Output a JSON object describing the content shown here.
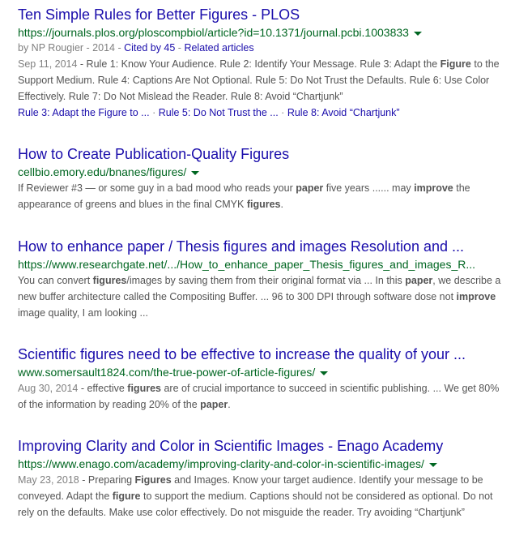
{
  "results": [
    {
      "title": "Ten Simple Rules for Better Figures - PLOS",
      "url": "https://journals.plos.org/ploscompbiol/article?id=10.1371/journal.pcbi.1003833",
      "meta": {
        "by": "by NP Rougier - 2014 - ",
        "cited_by": "Cited by 45",
        "sep": " - ",
        "related": "Related articles"
      },
      "date": "Sep 11, 2014",
      "snippet_parts": [
        " - Rule 1: Know Your Audience. Rule 2: Identify Your Message. Rule 3: Adapt the ",
        "Figure",
        " to the Support Medium. Rule 4: Captions Are Not Optional. Rule 5: Do Not Trust the Defaults. Rule 6: Use Color Effectively. Rule 7: Do Not Mislead the Reader. Rule 8: Avoid “Chartjunk”"
      ],
      "sitelinks": [
        "Rule 3: Adapt the Figure to ...",
        "Rule 5: Do Not Trust the ...",
        "Rule 8: Avoid “Chartjunk”"
      ],
      "sitelink_sep": " · "
    },
    {
      "title": "How to Create Publication-Quality Figures",
      "url": "cellbio.emory.edu/bnanes/figures/",
      "snippet_parts": [
        "If Reviewer #3 — or some guy in a bad mood who reads your ",
        "paper",
        " five years ...... may ",
        "improve",
        " the appearance of greens and blues in the final CMYK ",
        "figures",
        "."
      ]
    },
    {
      "title": "How to enhance paper / Thesis figures and images Resolution and ...",
      "url": "https://www.researchgate.net/.../How_to_enhance_paper_Thesis_figures_and_images_R...",
      "snippet_parts": [
        "You can convert ",
        "figures",
        "/images by saving them from their original format via ... In this ",
        "paper",
        ", we describe a new buffer architecture called the Compositing Buffer. ... 96 to 300 DPI through software dose not ",
        "improve",
        " image quality, I am looking ..."
      ]
    },
    {
      "title": "Scientific figures need to be effective to increase the quality of your ...",
      "url": "www.somersault1824.com/the-true-power-of-article-figures/",
      "date": "Aug 30, 2014",
      "snippet_parts": [
        " - effective ",
        "figures",
        " are of crucial importance to succeed in scientific publishing. ... We get 80% of the information by reading 20% of the ",
        "paper",
        "."
      ]
    },
    {
      "title": "Improving Clarity and Color in Scientific Images - Enago Academy",
      "url": "https://www.enago.com/academy/improving-clarity-and-color-in-scientific-images/",
      "date": "May 23, 2018",
      "snippet_parts": [
        " - Preparing ",
        "Figures",
        " and Images. Know your target audience. Identify your message to be conveyed. Adapt the ",
        "figure",
        " to support the medium. Captions should not be considered as optional. Do not rely on the defaults. Make use color effectively. Do not misguide the reader. Try avoiding “Chartjunk”"
      ]
    }
  ]
}
